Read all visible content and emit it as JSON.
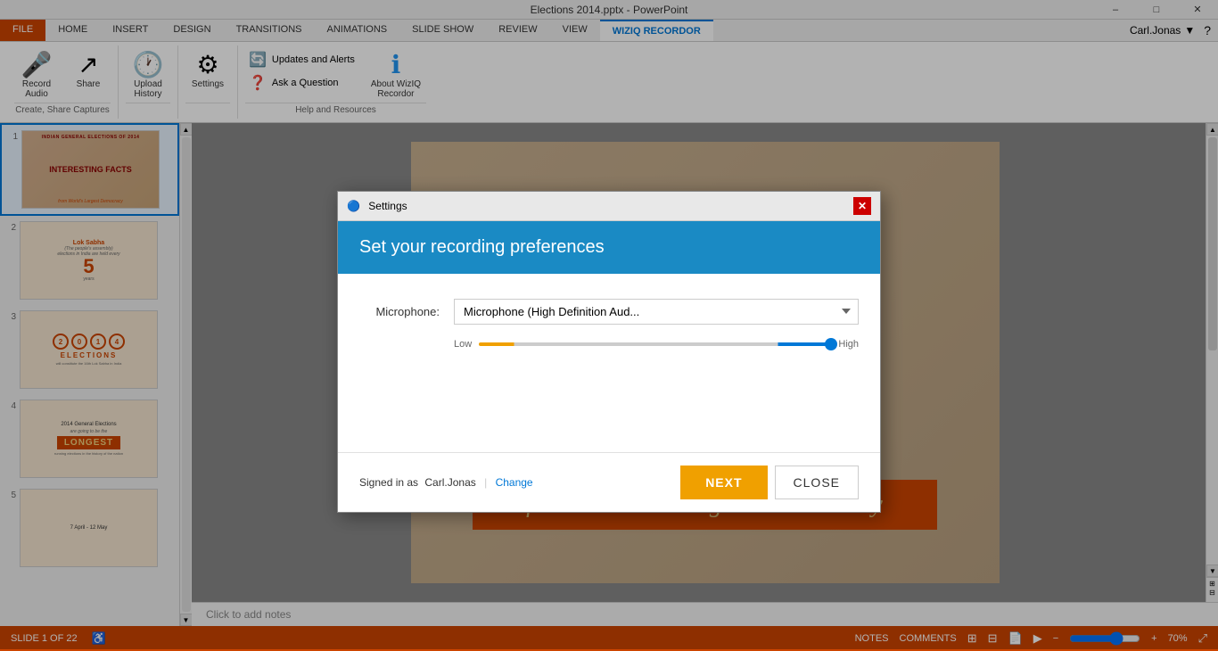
{
  "window": {
    "title": "Elections 2014.pptx - PowerPoint",
    "user": "Carl.Jonas"
  },
  "ribbon": {
    "tabs": [
      "FILE",
      "HOME",
      "INSERT",
      "DESIGN",
      "TRANSITIONS",
      "ANIMATIONS",
      "SLIDE SHOW",
      "REVIEW",
      "VIEW",
      "WizIQ Recordor"
    ],
    "active_tab": "WizIQ Recordor",
    "groups": {
      "create_share": {
        "record_audio_label": "Record\nAudio",
        "share_label": "Share",
        "label": "Create, Share Captures"
      },
      "upload": {
        "label": "Upload\nHistory"
      },
      "settings": {
        "label": "Settings"
      },
      "help": {
        "updates_label": "Updates and Alerts",
        "ask_label": "Ask a Question",
        "about_label": "About WizIQ\nRecordor",
        "label": "Help and Resources"
      }
    }
  },
  "slides": [
    {
      "num": "1",
      "type": "interesting_facts"
    },
    {
      "num": "2",
      "type": "lok_sabha"
    },
    {
      "num": "3",
      "type": "elections_2014"
    },
    {
      "num": "4",
      "type": "general_elections_longest"
    },
    {
      "num": "5",
      "type": "april_may"
    }
  ],
  "slide_notes": "Click to add notes",
  "modal": {
    "title": "Settings",
    "header": "Set your recording preferences",
    "microphone_label": "Microphone:",
    "microphone_value": "Microphone (High Definition Aud...",
    "slider_low": "Low",
    "slider_high": "High",
    "signed_in_text": "Signed in as",
    "signed_in_user": "Carl.Jonas",
    "change_label": "Change",
    "next_label": "NEXT",
    "close_label": "CLOSE"
  },
  "status_bar": {
    "slide_info": "SLIDE 1 OF 22",
    "notes_label": "NOTES",
    "comments_label": "COMMENTS",
    "zoom": "70%"
  }
}
